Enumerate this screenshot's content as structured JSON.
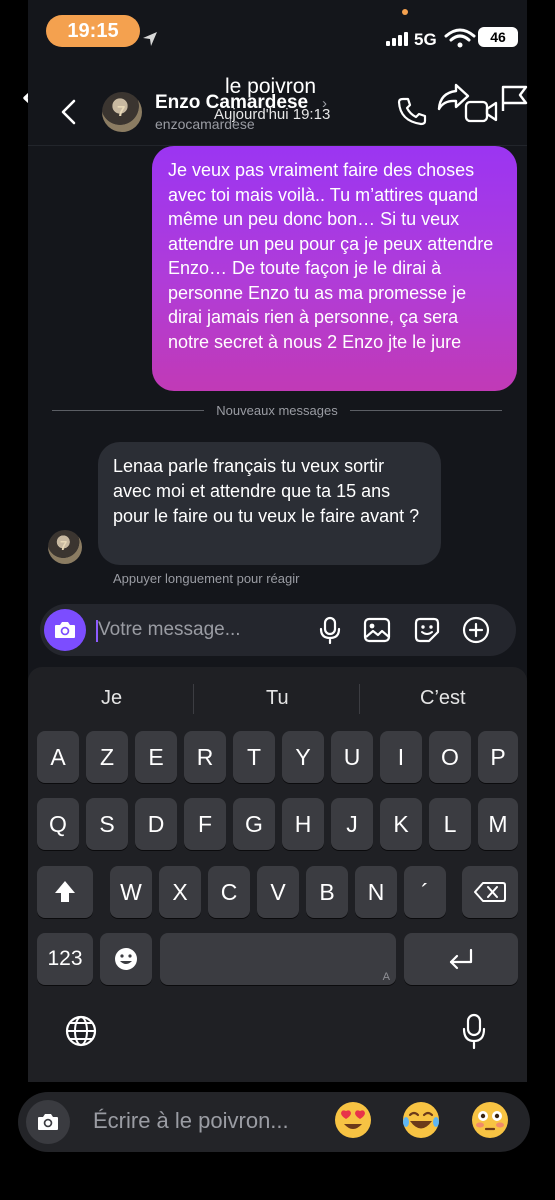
{
  "status_bar": {
    "time": "19:15",
    "network": "5G",
    "battery": "46"
  },
  "header": {
    "title": "le poivron",
    "subtitle": "Aujourd'hui 19:13",
    "contact_name": "Enzo Camardese",
    "contact_handle": "enzocamardese",
    "icons": [
      "back-icon",
      "phone-icon",
      "share-icon",
      "video-icon",
      "flag-icon"
    ]
  },
  "messages": [
    {
      "direction": "outgoing",
      "text": "Je veux pas vraiment faire des choses avec toi mais voilà.. Tu m’attires quand même un peu donc bon… Si tu veux attendre un peu pour ça je peux attendre Enzo… De toute façon je le dirai à personne Enzo tu as ma promesse je dirai jamais rien à personne, ça sera notre secret à nous 2 Enzo jte le jure"
    },
    {
      "direction": "incoming",
      "text": "Lenaa parle français tu veux sortir avec moi et attendre que ta 15 ans pour le faire ou tu veux le faire avant ?"
    }
  ],
  "divider_label": "Nouveaux messages",
  "reaction_hint": "Appuyer longuement pour réagir",
  "composer": {
    "placeholder": "Votre message...",
    "icons": [
      "camera-icon",
      "mic-icon",
      "gallery-icon",
      "sticker-icon",
      "add-icon"
    ]
  },
  "keyboard": {
    "predictions": [
      "Je",
      "Tu",
      "C’est"
    ],
    "row1": [
      "A",
      "Z",
      "E",
      "R",
      "T",
      "Y",
      "U",
      "I",
      "O",
      "P"
    ],
    "row2": [
      "Q",
      "S",
      "D",
      "F",
      "G",
      "H",
      "J",
      "K",
      "L",
      "M"
    ],
    "row3": [
      "W",
      "X",
      "C",
      "V",
      "B",
      "N",
      "´"
    ],
    "numbers_key": "123",
    "space_corner": "A"
  },
  "bottom_bar": {
    "placeholder": "Écrire à le poivron...",
    "quick_reactions": [
      "😍",
      "😂",
      "😳"
    ]
  }
}
